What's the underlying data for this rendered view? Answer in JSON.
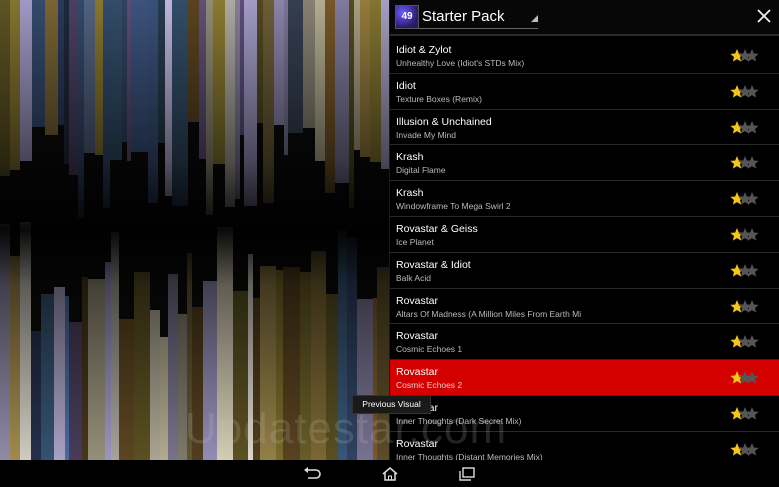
{
  "header": {
    "pack_icon_text": "49",
    "pack_title": "Starter Pack",
    "close_icon": "close-icon"
  },
  "tracks": [
    {
      "artist": "Idiot & Zylot",
      "title": "Unhealthy Love (Idiot's STDs Mix)",
      "rating": 1
    },
    {
      "artist": "Idiot",
      "title": "Texture Boxes (Remix)",
      "rating": 1
    },
    {
      "artist": "Illusion & Unchained",
      "title": "Invade My Mind",
      "rating": 1
    },
    {
      "artist": "Krash",
      "title": "Digital Flame",
      "rating": 1
    },
    {
      "artist": "Krash",
      "title": "Windowframe To Mega Swirl 2",
      "rating": 1
    },
    {
      "artist": "Rovastar & Geiss",
      "title": "Ice Planet",
      "rating": 1
    },
    {
      "artist": "Rovastar & Idiot",
      "title": "Balk Acid",
      "rating": 1
    },
    {
      "artist": "Rovastar",
      "title": "Altars Of Madness (A Million Miles From Earth Mi",
      "rating": 1
    },
    {
      "artist": "Rovastar",
      "title": "Cosmic Echoes 1",
      "rating": 1
    },
    {
      "artist": "Rovastar",
      "title": "Cosmic Echoes 2",
      "rating": 1,
      "selected": true
    },
    {
      "artist": "Rovastar",
      "title": "Inner Thoughts (Dark Secret Mix)",
      "rating": 1
    },
    {
      "artist": "Rovastar",
      "title": "Inner Thoughts (Distant Memories Mix)",
      "rating": 1
    }
  ],
  "tooltip": "Previous Visual",
  "watermark": "Updatestar.com",
  "colors": {
    "selected_row": "#d40000",
    "star_filled": "#f5c518",
    "star_empty": "#555555"
  },
  "nav": {
    "back_icon": "back-icon",
    "home_icon": "home-icon",
    "recents_icon": "recent-apps-icon"
  }
}
